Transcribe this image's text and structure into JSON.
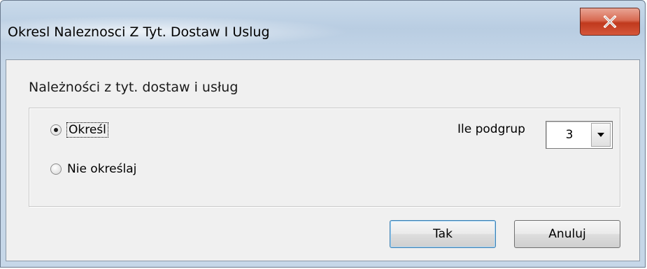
{
  "window": {
    "title": "Okresl Naleznosci Z Tyt. Dostaw I Uslug",
    "close_symbol": "X"
  },
  "dialog": {
    "heading": "Należności z tyt. dostaw i usług",
    "options": [
      {
        "label": "Określ",
        "checked": true
      },
      {
        "label": "Nie określaj",
        "checked": false
      }
    ],
    "subgroups": {
      "label": "Ile podgrup",
      "value": "3"
    }
  },
  "buttons": {
    "ok": "Tak",
    "cancel": "Anuluj"
  },
  "colors": {
    "close_button": "#c0391d",
    "client_bg": "#f0f0f0",
    "frame": "#b9cde2"
  },
  "icons": {
    "close": "close-icon",
    "dropdown": "chevron-down-icon"
  }
}
